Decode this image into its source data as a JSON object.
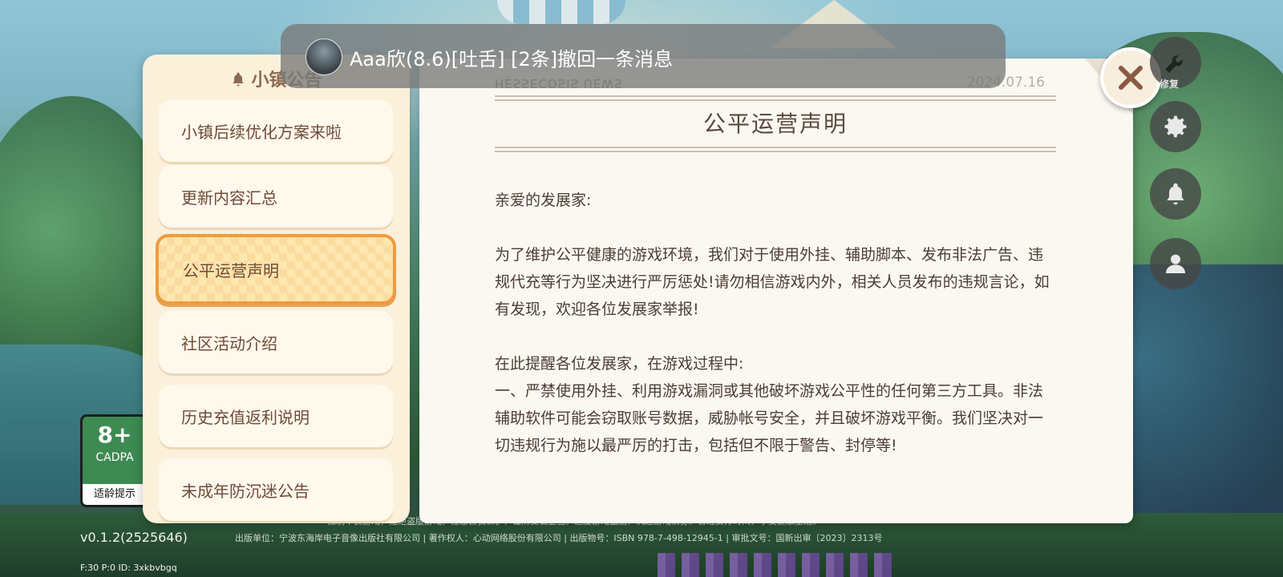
{
  "notification": {
    "message": "Aaa欣(8.6)[吐舌]  [2条]撤回一条消息"
  },
  "menu": {
    "header": "小镇公告",
    "items": [
      {
        "label": "小镇后续优化方案来啦",
        "active": false
      },
      {
        "label": "更新内容汇总",
        "active": false
      },
      {
        "label": "公平运营声明",
        "active": true
      },
      {
        "label": "社区活动介绍",
        "active": false
      },
      {
        "label": "历史充值返利说明",
        "active": false
      },
      {
        "label": "未成年防沉迷公告",
        "active": false
      }
    ]
  },
  "notice": {
    "mirror_text": "HESSECOSIS UEWS",
    "date": "2024.07.16",
    "title": "公平运营声明",
    "greeting": "亲爱的发展家:",
    "para1": "为了维护公平健康的游戏环境，我们对于使用外挂、辅助脚本、发布非法广告、违规代充等行为坚决进行严厉惩处!请勿相信游戏内外，相关人员发布的违规言论，如有发现，欢迎各位发展家举报!",
    "para2_intro": "在此提醒各位发展家，在游戏过程中:",
    "para2_item1": "一、严禁使用外挂、利用游戏漏洞或其他破坏游戏公平性的任何第三方工具。非法辅助软件可能会窃取账号数据，威胁帐号安全，并且破坏游戏平衡。我们坚决对一切违规行为施以最严厉的打击，包括但不限于警告、封停等!"
  },
  "side": {
    "repair_label": "修复"
  },
  "age_rating": {
    "rating": "8+",
    "org": "CADPA",
    "hint": "适龄提示"
  },
  "footer": {
    "legal_line1": "抵制不良游戏，拒绝盗版游戏。注意自我保护，谨防受骗上当。适度游戏益脑，沉迷游戏伤身。合理安排时间，享受健康生活。",
    "legal_line2": "出版单位：宁波东海岸电子音像出版社有限公司 | 著作权人：心动网络股份有限公司 | 出版物号：ISBN 978-7-498-12945-1 | 审批文号：国新出审〔2023〕2313号",
    "version": "v0.1.2(2525646)",
    "debug": "F:30   P:0   ID: 3xkbvbgq"
  },
  "colors": {
    "accent_orange": "#f19a3e",
    "panel_cream": "#fbf0da",
    "text_brown": "#6e4b38",
    "close_x": "#8a5a44"
  }
}
